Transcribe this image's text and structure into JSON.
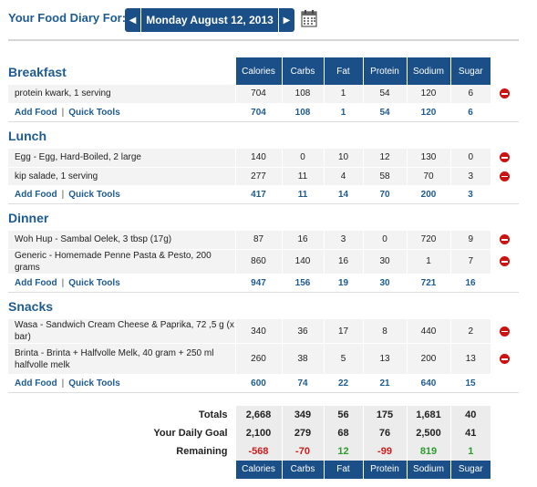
{
  "header": {
    "label": "Your Food Diary For:",
    "date": "Monday August 12, 2013",
    "prev_icon": "arrow-left-icon",
    "next_icon": "arrow-right-icon",
    "calendar_icon": "calendar-icon"
  },
  "columns": [
    "Calories",
    "Carbs",
    "Fat",
    "Protein",
    "Sodium",
    "Sugar"
  ],
  "links": {
    "add_food": "Add Food",
    "separator": "|",
    "quick_tools": "Quick Tools"
  },
  "meals": [
    {
      "name": "Breakfast",
      "foods": [
        {
          "name": "protein kwark, 1 serving",
          "values": [
            "704",
            "108",
            "1",
            "54",
            "120",
            "6"
          ]
        }
      ],
      "totals": [
        "704",
        "108",
        "1",
        "54",
        "120",
        "6"
      ]
    },
    {
      "name": "Lunch",
      "foods": [
        {
          "name": "Egg - Egg, Hard-Boiled, 2 large",
          "values": [
            "140",
            "0",
            "10",
            "12",
            "130",
            "0"
          ]
        },
        {
          "name": "kip salade, 1 serving",
          "values": [
            "277",
            "11",
            "4",
            "58",
            "70",
            "3"
          ]
        }
      ],
      "totals": [
        "417",
        "11",
        "14",
        "70",
        "200",
        "3"
      ]
    },
    {
      "name": "Dinner",
      "foods": [
        {
          "name": "Woh Hup - Sambal Oelek, 3 tbsp (17g)",
          "values": [
            "87",
            "16",
            "3",
            "0",
            "720",
            "9"
          ]
        },
        {
          "name": "Generic - Homemade Penne Pasta & Pesto, 200 grams",
          "values": [
            "860",
            "140",
            "16",
            "30",
            "1",
            "7"
          ]
        }
      ],
      "totals": [
        "947",
        "156",
        "19",
        "30",
        "721",
        "16"
      ]
    },
    {
      "name": "Snacks",
      "foods": [
        {
          "name": "Wasa - Sandwich Cream Cheese & Paprika, 72 ,5 g (x bar)",
          "values": [
            "340",
            "36",
            "17",
            "8",
            "440",
            "2"
          ]
        },
        {
          "name": "Brinta - Brinta + Halfvolle Melk, 40 gram + 250 ml halfvolle melk",
          "values": [
            "260",
            "38",
            "5",
            "13",
            "200",
            "13"
          ]
        }
      ],
      "totals": [
        "600",
        "74",
        "22",
        "21",
        "640",
        "15"
      ]
    }
  ],
  "summary": {
    "totals": {
      "label": "Totals",
      "values": [
        "2,668",
        "349",
        "56",
        "175",
        "1,681",
        "40"
      ]
    },
    "goal": {
      "label": "Your Daily Goal",
      "values": [
        "2,100",
        "279",
        "68",
        "76",
        "2,500",
        "41"
      ]
    },
    "remaining": {
      "label": "Remaining",
      "values": [
        "-568",
        "-70",
        "12",
        "-99",
        "819",
        "1"
      ]
    }
  },
  "colors": {
    "header_blue": "#1b4f87",
    "link_blue": "#1e5b92",
    "negative_red": "#d11b1b",
    "positive_green": "#2e9b2e",
    "delete_red": "#cc1111"
  }
}
